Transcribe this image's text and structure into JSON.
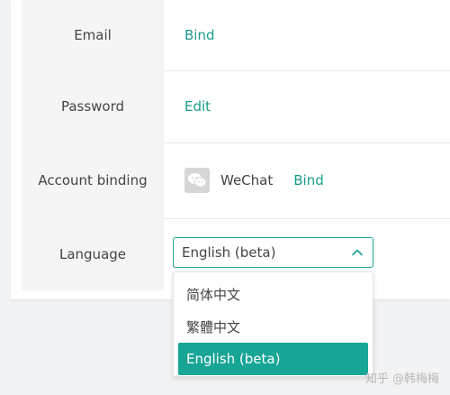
{
  "settings": {
    "email": {
      "label": "Email",
      "action": "Bind"
    },
    "password": {
      "label": "Password",
      "action": "Edit"
    },
    "account_binding": {
      "label": "Account binding",
      "service": "WeChat",
      "service_icon": "wechat-icon",
      "action": "Bind"
    },
    "language": {
      "label": "Language",
      "selected": "English (beta)",
      "options": [
        "简体中文",
        "繁體中文",
        "English (beta)"
      ],
      "open": true
    }
  },
  "colors": {
    "accent": "#1a9c8d",
    "selected_option_bg": "#17a596",
    "label_cell_bg": "#f5f5f5"
  },
  "watermark": "知乎 @韩梅梅"
}
